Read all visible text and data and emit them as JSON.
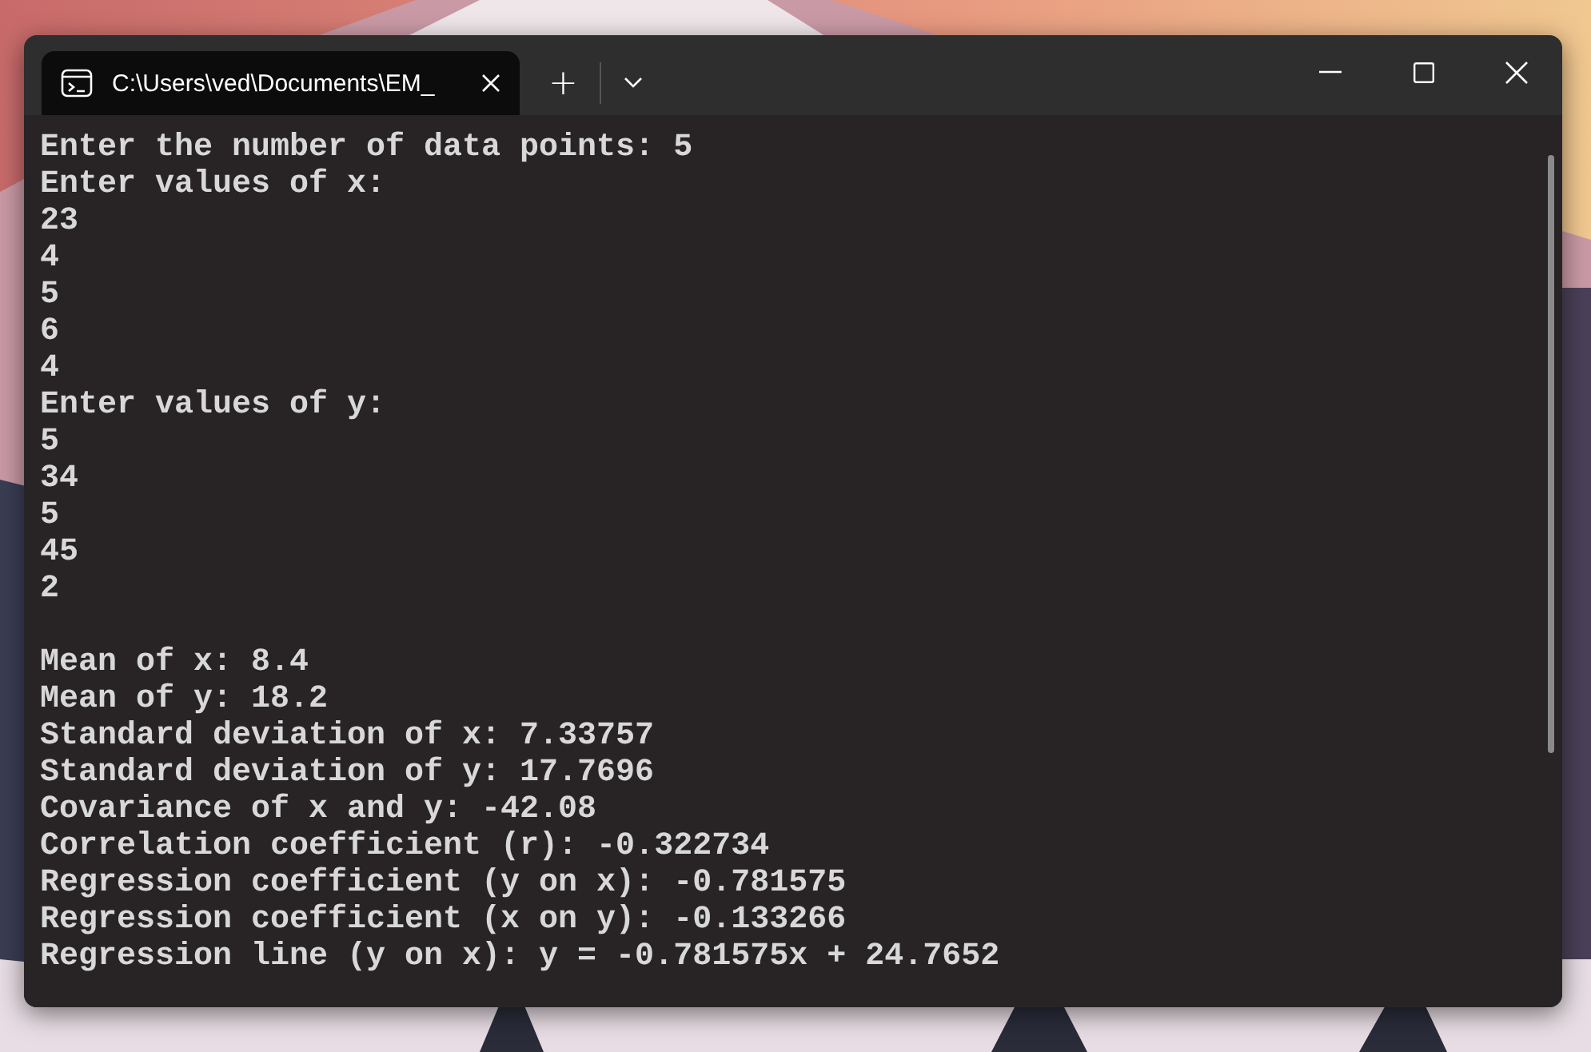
{
  "tab": {
    "title": "C:\\Users\\ved\\Documents\\EM_",
    "selected": true
  },
  "tab_bar": {
    "new_tab": "+"
  },
  "console": {
    "input_lines": [
      "Enter the number of data points: 5",
      "Enter values of x:",
      "23",
      "4",
      "5",
      "6",
      "4",
      "Enter values of y:",
      "5",
      "34",
      "5",
      "45",
      "2"
    ],
    "output_lines": [
      "Mean of x: 8.4",
      "Mean of y: 18.2",
      "Standard deviation of x: 7.33757",
      "Standard deviation of y: 17.7696",
      "Covariance of x and y: -42.08",
      "Correlation coefficient (r): -0.322734",
      "Regression coefficient (y on x): -0.781575",
      "Regression coefficient (x on y): -0.133266",
      "Regression line (y on x): y = -0.781575x + 24.7652"
    ]
  }
}
